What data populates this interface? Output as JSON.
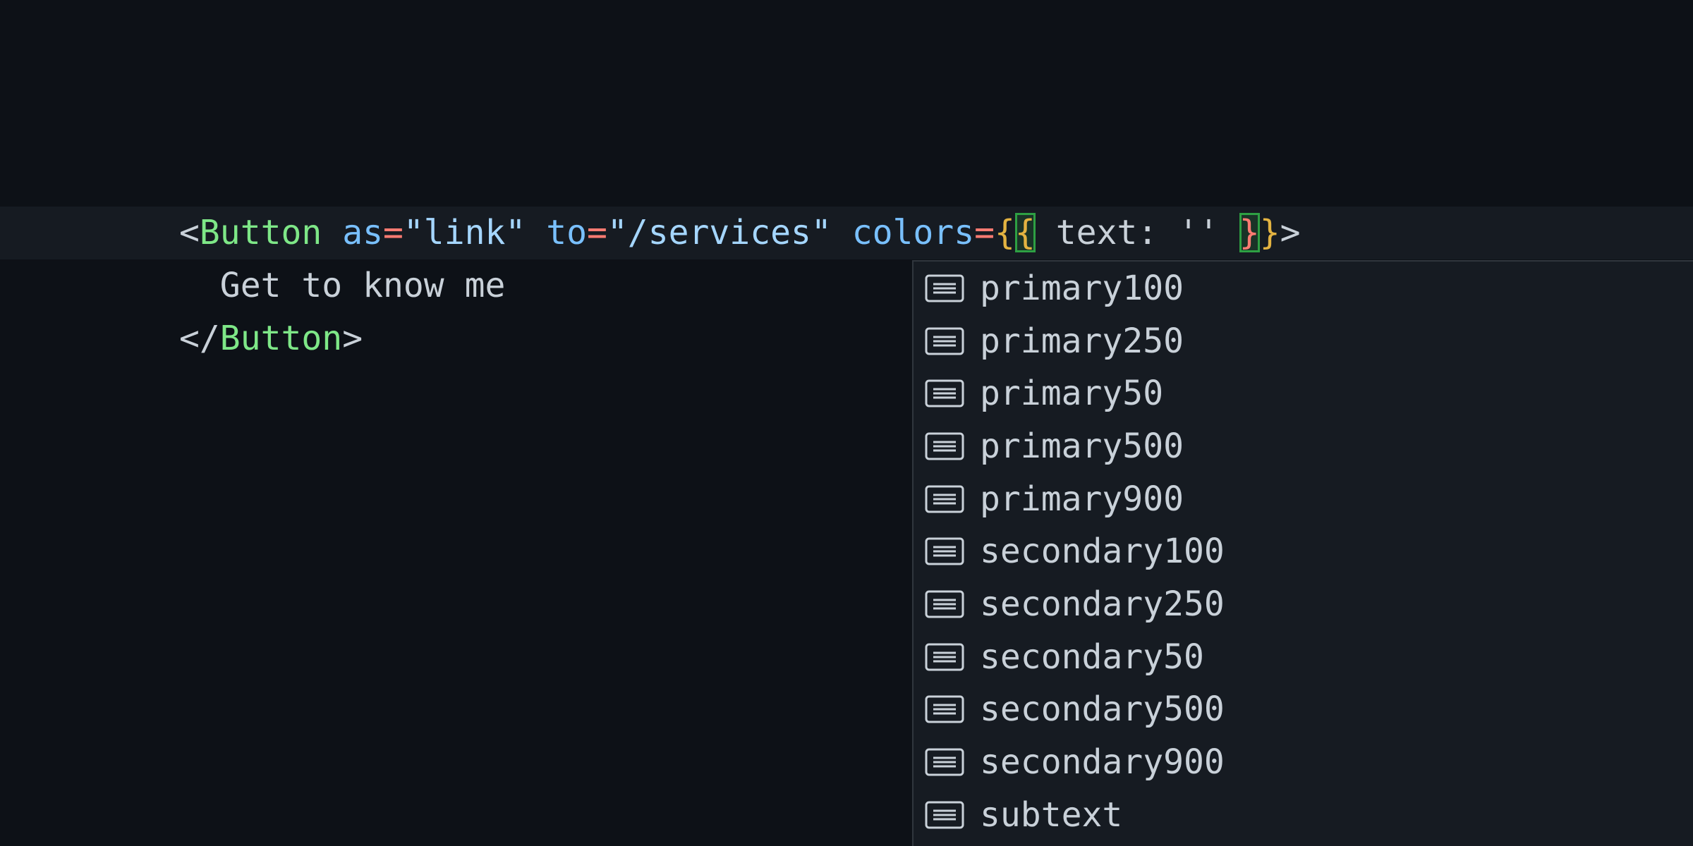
{
  "editor": {
    "line1": {
      "lt": "<",
      "tag": "Button",
      "attr_as": "as",
      "eq1": "=",
      "val_as": "\"link\"",
      "attr_to": "to",
      "eq2": "=",
      "val_to": "\"/services\"",
      "attr_colors": "colors",
      "eq3": "=",
      "open_outer": "{",
      "open_inner": "{",
      "text_prop": " text: '' ",
      "close_inner": "}",
      "close_outer": "}",
      "gt": ">"
    },
    "line2": {
      "text": "  Get to know me"
    },
    "line3": {
      "lt": "</",
      "tag": "Button",
      "gt": ">"
    }
  },
  "suggestions": {
    "icon": "field-icon",
    "items": [
      "primary100",
      "primary250",
      "primary50",
      "primary500",
      "primary900",
      "secondary100",
      "secondary250",
      "secondary50",
      "secondary500",
      "secondary900",
      "subtext"
    ]
  },
  "colors": {
    "background": "#0d1117",
    "current_line": "#161b22",
    "tag": "#7ee787",
    "attribute": "#79c0ff",
    "operator": "#ff7b72",
    "string": "#a5d6ff",
    "brace": "#e3b341",
    "bracket_match": "#2ea043"
  }
}
